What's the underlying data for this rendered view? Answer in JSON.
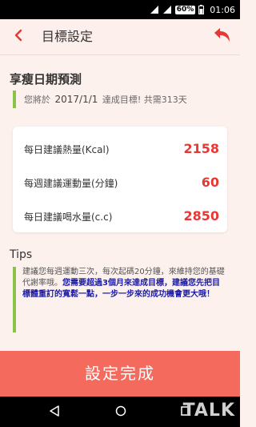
{
  "status_bar": {
    "battery_percent": "60%",
    "time": "01:06"
  },
  "app_bar": {
    "title": "目標設定"
  },
  "prediction": {
    "heading": "享瘦日期預測",
    "prefix": "您將於",
    "target_date": "2017/1/1",
    "suffix": "達成目標! 共需313天"
  },
  "recommendations": [
    {
      "label": "每日建議熱量(Kcal)",
      "value": "2158"
    },
    {
      "label": "每週建議運動量(分鐘)",
      "value": "60"
    },
    {
      "label": "每日建議喝水量(c.c)",
      "value": "2850"
    }
  ],
  "tips": {
    "heading": "Tips",
    "normal_text": "建議您每週運動三次，每次起碼20分鐘，來維持您的基礎代謝率哦。",
    "highlight_text": "您需要超過3個月來達成目標，建議您先把目標體重訂的寬鬆一點，一步一步來的成功機會更大哦！"
  },
  "done_button": {
    "label": "設定完成"
  },
  "watermark": "TALK",
  "colors": {
    "accent": "#f46b5e",
    "value_red": "#e53935",
    "green_bar": "#8bc34a",
    "highlight_blue": "#1a1aa6"
  }
}
